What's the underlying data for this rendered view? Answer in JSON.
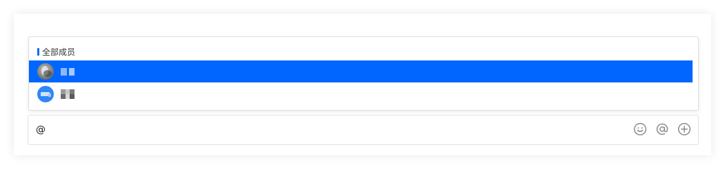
{
  "mention_popup": {
    "group_label": "全部成员",
    "members": [
      {
        "name": "",
        "selected": true,
        "avatar": "photo-avatar"
      },
      {
        "name": "",
        "selected": false,
        "avatar": "bot-avatar"
      }
    ]
  },
  "composer": {
    "input_value": "@",
    "toolbar": [
      {
        "icon": "emoji-icon"
      },
      {
        "icon": "at-mention-icon"
      },
      {
        "icon": "add-icon"
      }
    ]
  },
  "colors": {
    "accent": "#0066ff",
    "avatar_blue": "#2f86f6",
    "icon_gray": "#8a8a8a"
  }
}
